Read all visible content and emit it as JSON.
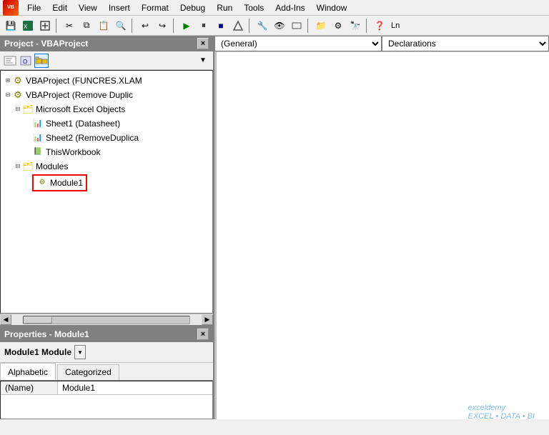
{
  "menubar": {
    "items": [
      "File",
      "Edit",
      "View",
      "Insert",
      "Format",
      "Debug",
      "Run",
      "Tools",
      "Add-Ins",
      "Window"
    ]
  },
  "toolbar": {
    "ln_label": "Ln"
  },
  "project_panel": {
    "title": "Project - VBAProject",
    "close_btn": "×"
  },
  "tree": {
    "items": [
      {
        "id": "vbaproject1",
        "label": "VBAProject (FUNCRES.XLAM",
        "indent": 0,
        "expanded": true,
        "type": "vba"
      },
      {
        "id": "vbaproject2",
        "label": "VBAProject (Remove Duplic",
        "indent": 0,
        "expanded": true,
        "type": "vba"
      },
      {
        "id": "excelobjects",
        "label": "Microsoft Excel Objects",
        "indent": 1,
        "expanded": true,
        "type": "folder"
      },
      {
        "id": "sheet1",
        "label": "Sheet1 (Datasheet)",
        "indent": 2,
        "expanded": false,
        "type": "sheet"
      },
      {
        "id": "sheet2",
        "label": "Sheet2 (RemoveDuplica",
        "indent": 2,
        "expanded": false,
        "type": "sheet"
      },
      {
        "id": "thisworkbook",
        "label": "ThisWorkbook",
        "indent": 2,
        "expanded": false,
        "type": "workbook"
      },
      {
        "id": "modules",
        "label": "Modules",
        "indent": 1,
        "expanded": true,
        "type": "folder"
      },
      {
        "id": "module1",
        "label": "Module1",
        "indent": 2,
        "expanded": false,
        "type": "module",
        "highlighted": true
      }
    ]
  },
  "properties_panel": {
    "title": "Properties - Module1",
    "close_btn": "×",
    "module_type": "Module1 Module",
    "tabs": [
      "Alphabetic",
      "Categorized"
    ],
    "active_tab": "Alphabetic",
    "rows": [
      {
        "name": "(Name)",
        "value": "Module1"
      }
    ]
  },
  "code_editor": {
    "dropdown_value": "(General)",
    "placeholder": ""
  },
  "watermark": "exceldemy\nEXCEL • DATA • BI"
}
